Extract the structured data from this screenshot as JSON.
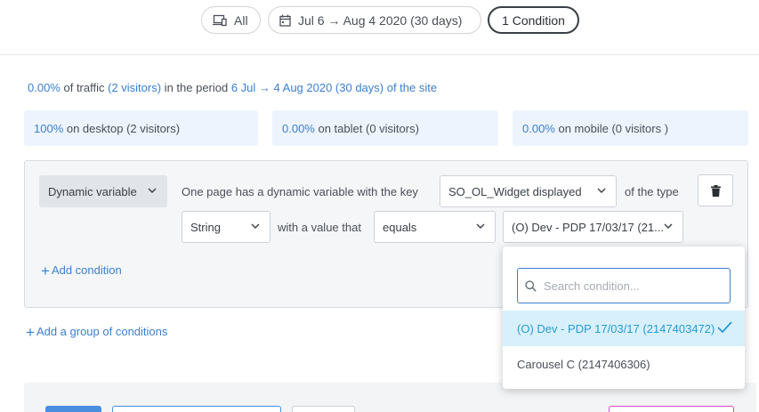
{
  "filters": {
    "devices_label": "All",
    "period_label": "Jul 6 → Aug 4 2020 (30 days)",
    "conditions_label": "1 Condition"
  },
  "summary": {
    "traffic_pct": "0.00%",
    "of_traffic": " of traffic ",
    "visitors": "(2 visitors)",
    "in_period": " in the period ",
    "period": "6 Jul → 4 Aug 2020 (30 days) of the site"
  },
  "devices": [
    {
      "pct": "100%",
      "label": " on desktop ",
      "visitors": "(2 visitors)"
    },
    {
      "pct": "0.00%",
      "label": " on tablet ",
      "visitors": "(0 visitors)"
    },
    {
      "pct": "0.00%",
      "label": " on mobile ",
      "visitors": "(0 visitors )"
    }
  ],
  "condition": {
    "type_label": "Dynamic variable",
    "sentence_1": "One page has a dynamic variable with the key",
    "key_value": "SO_OL_Widget displayed",
    "sentence_2": "of the type",
    "type_value": "String",
    "sentence_3": "with a value that",
    "operator_value": "equals",
    "value_value": "(O) Dev - PDP 17/03/17 (21..."
  },
  "actions": {
    "add_condition": "Add condition",
    "add_group": "Add a group of conditions"
  },
  "dropdown": {
    "search_placeholder": "Search condition...",
    "options": [
      {
        "label": "(O) Dev - PDP 17/03/17 (2147403472)",
        "selected": true
      },
      {
        "label": "Carousel C (2147406306)",
        "selected": false
      }
    ]
  },
  "colors": {
    "accent": "#3b7fd1",
    "selected_bg": "#d8f0fc",
    "selected_text": "#2a9ad6"
  }
}
